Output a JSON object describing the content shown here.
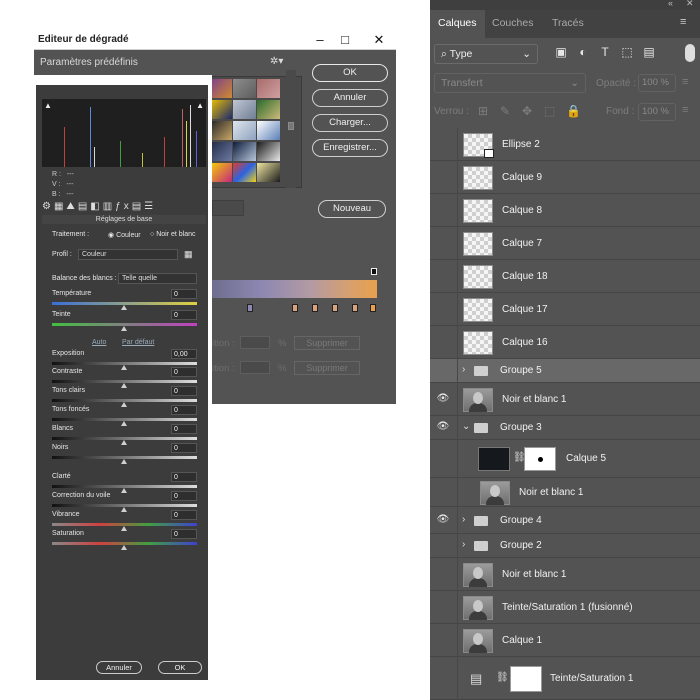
{
  "gradient_editor": {
    "title": "Editeur de dégradé",
    "presets_label": "Paramètres prédéfinis",
    "buttons": {
      "ok": "OK",
      "cancel": "Annuler",
      "load": "Charger...",
      "save": "Enregistrer...",
      "new": "Nouveau"
    },
    "ghost": {
      "position1": "ition :",
      "position2": "ition :",
      "percent": "%",
      "delete": "Supprimer"
    }
  },
  "camera_raw": {
    "rgb": {
      "r": "R :",
      "v": "V :",
      "b": "B :",
      "dash": "---"
    },
    "section_title": "Réglages de base",
    "treatment_label": "Traitement :",
    "treatment_color": "Couleur",
    "treatment_bw": "Noir et blanc",
    "profile_label": "Profil :",
    "profile_value": "Couleur",
    "wb_label": "Balance des blancs :",
    "wb_value": "Telle quelle",
    "auto": "Auto",
    "default": "Par défaut",
    "sliders": [
      {
        "label": "Température",
        "value": "0"
      },
      {
        "label": "Teinte",
        "value": "0"
      },
      {
        "label": "Exposition",
        "value": "0,00"
      },
      {
        "label": "Contraste",
        "value": "0"
      },
      {
        "label": "Tons clairs",
        "value": "0"
      },
      {
        "label": "Tons foncés",
        "value": "0"
      },
      {
        "label": "Blancs",
        "value": "0"
      },
      {
        "label": "Noirs",
        "value": "0"
      },
      {
        "label": "Clarté",
        "value": "0"
      },
      {
        "label": "Correction du voile",
        "value": "0"
      },
      {
        "label": "Vibrance",
        "value": "0"
      },
      {
        "label": "Saturation",
        "value": "0"
      }
    ],
    "cancel": "Annuler",
    "ok": "OK"
  },
  "layers_panel": {
    "tabs": [
      "Calques",
      "Couches",
      "Tracés"
    ],
    "filter_type": "Type",
    "blend_mode": "Transfert",
    "opacity_label": "Opacité :",
    "opacity_value": "100 %",
    "lock_label": "Verrou :",
    "fill_label": "Fond :",
    "fill_value": "100 %",
    "layers": [
      {
        "name": "Ellipse 2",
        "kind": "shape",
        "visible": false
      },
      {
        "name": "Calque 9",
        "kind": "empty",
        "visible": false
      },
      {
        "name": "Calque 8",
        "kind": "empty",
        "visible": false
      },
      {
        "name": "Calque 7",
        "kind": "empty",
        "visible": false
      },
      {
        "name": "Calque 18",
        "kind": "empty",
        "visible": false
      },
      {
        "name": "Calque 17",
        "kind": "empty",
        "visible": false
      },
      {
        "name": "Calque 16",
        "kind": "empty",
        "visible": false
      },
      {
        "name": "Groupe 5",
        "kind": "group",
        "visible": false,
        "selected": true
      },
      {
        "name": "Noir et blanc 1",
        "kind": "photo",
        "visible": true
      },
      {
        "name": "Groupe 3",
        "kind": "group-open",
        "visible": true
      },
      {
        "name": "Calque 5",
        "kind": "masked",
        "visible": false
      },
      {
        "name": "Noir et blanc 1",
        "kind": "photo-indent",
        "visible": false
      },
      {
        "name": "Groupe 4",
        "kind": "group",
        "visible": true
      },
      {
        "name": "Groupe 2",
        "kind": "group",
        "visible": false
      },
      {
        "name": "Noir et blanc 1",
        "kind": "photo",
        "visible": false
      },
      {
        "name": "Teinte/Saturation 1 (fusionné)",
        "kind": "photo",
        "visible": false
      },
      {
        "name": "Calque 1",
        "kind": "photo",
        "visible": false
      },
      {
        "name": "Teinte/Saturation 1",
        "kind": "adjustment",
        "visible": false
      }
    ]
  }
}
